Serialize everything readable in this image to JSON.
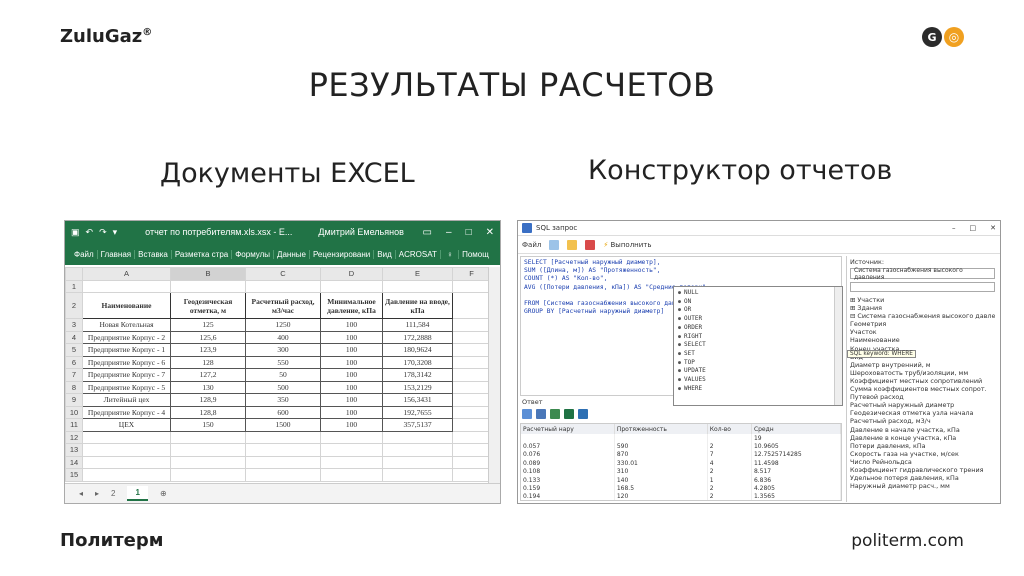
{
  "header": {
    "brand": "ZuluGaz",
    "brand_mark": "®",
    "logo_left_letter": "G"
  },
  "title": "РЕЗУЛЬТАТЫ РАСЧЕТОВ",
  "left_caption": "Документы EXCEL",
  "right_caption": "Конструктор отчетов",
  "footer": {
    "company": "Политерм",
    "url": "politerm.com"
  },
  "excel": {
    "window_title": "отчет по потребителям.xls.xsx - E...",
    "user": "Дмитрий Емельянов",
    "ribbon_tabs": [
      "Файл",
      "Главная",
      "Вставка",
      "Разметка стра",
      "Формулы",
      "Данные",
      "Рецензировани",
      "Вид",
      "ACROSAT",
      "Помощ"
    ],
    "columns": [
      "A",
      "B",
      "C",
      "D",
      "E",
      "F"
    ],
    "header_row": [
      "Наименование",
      "Геодезическая отметка, м",
      "Расчетный расход, м3/час",
      "Минимальное давление, кПа",
      "Давление на вводе, кПа"
    ],
    "rows": [
      [
        "Новая Котельная",
        "125",
        "1250",
        "100",
        "111,584"
      ],
      [
        "Предприятие Корпус - 2",
        "125,6",
        "400",
        "100",
        "172,2888"
      ],
      [
        "Предприятие Корпус - 1",
        "123,9",
        "300",
        "100",
        "180,9624"
      ],
      [
        "Предприятие Корпус - 6",
        "128",
        "550",
        "100",
        "170,3208"
      ],
      [
        "Предприятие Корпус - 7",
        "127,2",
        "50",
        "100",
        "178,3142"
      ],
      [
        "Предприятие Корпус - 5",
        "130",
        "500",
        "100",
        "153,2129"
      ],
      [
        "Литейный цех",
        "128,9",
        "350",
        "100",
        "156,3431"
      ],
      [
        "Предприятие Корпус - 4",
        "128,8",
        "600",
        "100",
        "192,7655"
      ],
      [
        "ЦЕХ",
        "150",
        "1500",
        "100",
        "357,5137"
      ]
    ],
    "sheet_tabs": [
      "2",
      "1"
    ],
    "active_sheet": "1"
  },
  "sql": {
    "window_title": "SQL запрос",
    "toolbar_file": "Файл",
    "toolbar_run": "Выполнить",
    "editor_lines": [
      "SELECT [Расчетный наружный диаметр],",
      "SUM ([Длина, м]) AS \"Протяженность\",",
      "COUNT (*) AS \"Кол-во\",",
      "AVG ([Потери давления, кПа]) AS \"Средние потери\"",
      "",
      "FROM [Система газоснабжения высокого давления]",
      "GROUP BY [Расчетный наружный диаметр]"
    ],
    "autocomplete": [
      "NULL",
      "ON",
      "OR",
      "OUTER",
      "ORDER",
      "RIGHT",
      "SELECT",
      "SET",
      "TOP",
      "UPDATE",
      "VALUES",
      "WHERE"
    ],
    "result_label": "Ответ",
    "result_headers": [
      "Расчетный нару",
      "Протяженность",
      "Кол-во",
      "Средн"
    ],
    "result_rows": [
      [
        "",
        "",
        "",
        "19"
      ],
      [
        "0.057",
        "590",
        "2",
        "10.9605"
      ],
      [
        "0.076",
        "870",
        "7",
        "12.7525714285"
      ],
      [
        "0.089",
        "330.01",
        "4",
        "11.4598"
      ],
      [
        "0.108",
        "310",
        "2",
        "8.517"
      ],
      [
        "0.133",
        "140",
        "1",
        "6.836"
      ],
      [
        "0.159",
        "168.5",
        "2",
        "4.2805"
      ],
      [
        "0.194",
        "120",
        "2",
        "1.3565"
      ]
    ],
    "side_label": "Источник:",
    "side_combo": "Система газоснабжения высокого давления",
    "tree": [
      "⊞ Участки",
      "⊞ Здания",
      "⊟ Система газоснабжения высокого давления",
      "    Геометрия",
      "    Участок",
      "      Наименование",
      "      Конец участка",
      "      Вид",
      "      Диаметр внутренний, м",
      "      Шероховатость труб/изоляции, мм",
      "      Коэффициент местных сопротивлений",
      "      Сумма коэффициентов местных сопрот.",
      "      Путевой расход",
      "      Расчетный наружный диаметр",
      "      Геодезическая отметка узла начала",
      "      Расчетный расход, м3/ч",
      "      Давление в начале участка, кПа",
      "      Давление в конце участка, кПа",
      "      Потери давления, кПа",
      "      Скорость газа на участке, м/сек",
      "      Число Рейнольдса",
      "      Коэффициент гидравлического трения",
      "      Удельное потеря давления, кПа",
      "      Наружный диаметр расч., мм"
    ],
    "tooltip": "SQL keyword: WHERE"
  }
}
